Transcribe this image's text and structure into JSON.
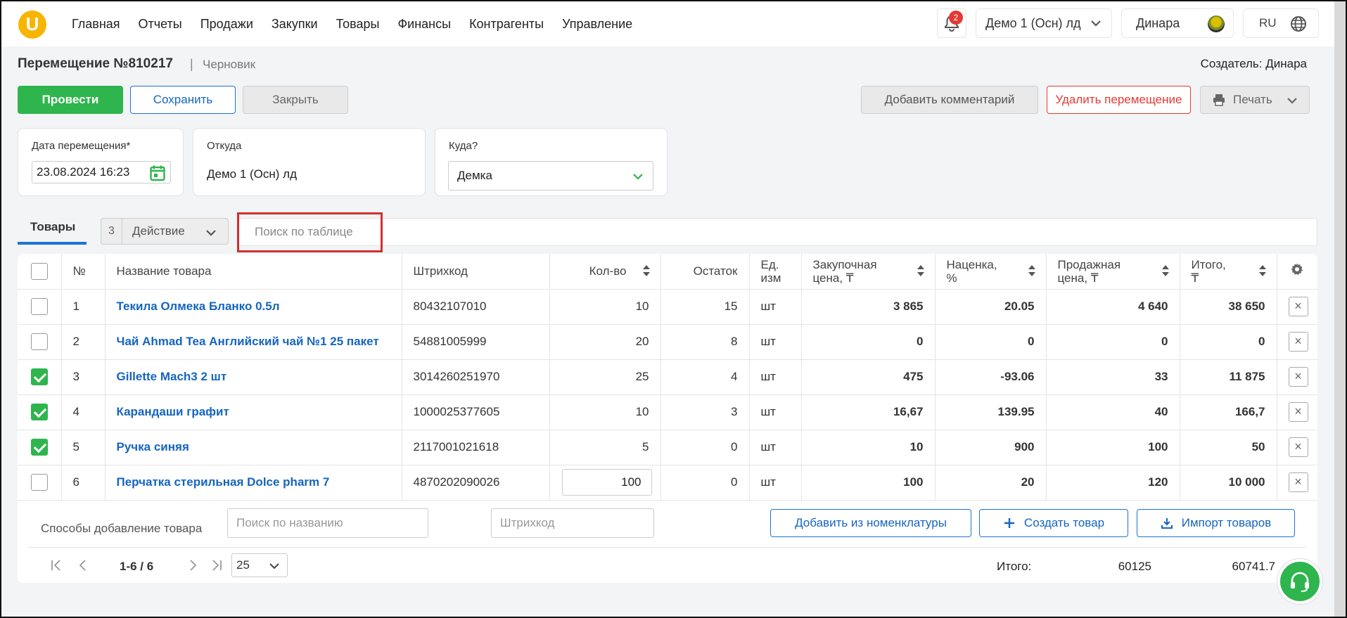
{
  "app": {
    "logo_letter": "U",
    "nav": [
      "Главная",
      "Отчеты",
      "Продажи",
      "Закупки",
      "Товары",
      "Финансы",
      "Контрагенты",
      "Управление"
    ],
    "notifications_count": "2",
    "organization": "Демо 1 (Осн) лд",
    "user_name": "Динара",
    "language": "RU"
  },
  "document": {
    "title": "Перемещение №810217",
    "separator": "|",
    "status": "Черновик",
    "creator": "Создатель: Динара"
  },
  "actions": {
    "post": "Провести",
    "save": "Сохранить",
    "close": "Закрыть",
    "add_comment": "Добавить комментарий",
    "delete": "Удалить перемещение",
    "print": "Печать"
  },
  "form": {
    "date_label": "Дата перемещения*",
    "date_value": "23.08.2024 16:23",
    "from_label": "Откуда",
    "from_value": "Демо 1 (Осн) лд",
    "to_label": "Куда?",
    "to_value": "Демка"
  },
  "toolbar": {
    "tab_products": "Товары",
    "selected_count": "3",
    "action_label": "Действие",
    "search_placeholder": "Поиск по таблице"
  },
  "table": {
    "columns": [
      "№",
      "Название товара",
      "Штрихкод",
      "Кол-во",
      "Остаток",
      "Ед. изм",
      "Закупочная цена, ₸",
      "Наценка, %",
      "Продажная цена, ₸",
      "Итого, ₸"
    ],
    "column_lines": {
      "unit": [
        "Ед.",
        "изм"
      ],
      "purchase": [
        "Закупочная",
        "цена, ₸"
      ],
      "markup": [
        "Наценка,",
        "%"
      ],
      "sale": [
        "Продажная",
        "цена, ₸"
      ],
      "total": [
        "Итого,",
        "₸"
      ]
    },
    "rows": [
      {
        "checked": false,
        "n": "1",
        "name": "Текила Олмека Бланко 0.5л",
        "barcode": "80432107010",
        "qty": "10",
        "stock": "15",
        "unit": "шт",
        "purchase": "3 865",
        "markup": "20.05",
        "sale": "4 640",
        "total": "38 650"
      },
      {
        "checked": false,
        "n": "2",
        "name": "Чай Ahmad Tea Английский чай №1 25 пакет",
        "barcode": "54881005999",
        "qty": "20",
        "stock": "8",
        "unit": "шт",
        "purchase": "0",
        "markup": "0",
        "sale": "0",
        "total": "0"
      },
      {
        "checked": true,
        "n": "3",
        "name": "Gillette Mach3 2 шт",
        "barcode": "3014260251970",
        "qty": "25",
        "stock": "4",
        "unit": "шт",
        "purchase": "475",
        "markup": "-93.06",
        "sale": "33",
        "total": "11 875"
      },
      {
        "checked": true,
        "n": "4",
        "name": "Карандаши графит",
        "barcode": "1000025377605",
        "qty": "10",
        "stock": "3",
        "unit": "шт",
        "purchase": "16,67",
        "markup": "139.95",
        "sale": "40",
        "total": "166,7"
      },
      {
        "checked": true,
        "n": "5",
        "name": "Ручка синяя",
        "barcode": "2117001021618",
        "qty": "5",
        "stock": "0",
        "unit": "шт",
        "purchase": "10",
        "markup": "900",
        "sale": "100",
        "total": "50"
      },
      {
        "checked": false,
        "n": "6",
        "name": "Перчатка стерильная Dolce pharm 7",
        "barcode": "4870202090026",
        "qty": "100",
        "stock": "0",
        "unit": "шт",
        "purchase": "100",
        "markup": "20",
        "sale": "120",
        "total": "10 000",
        "editing": true
      }
    ]
  },
  "add_products": {
    "label": "Способы добавление товара",
    "name_placeholder": "Поиск по названию",
    "barcode_placeholder": "Штрихкод",
    "from_catalog": "Добавить из номенклатуры",
    "create": "Создать товар",
    "import": "Импорт товаров"
  },
  "pager": {
    "range": "1-6 / 6",
    "per_page": "25",
    "total_label": "Итого:",
    "total_qty": "60125",
    "total_sum": "60741.7"
  },
  "colors": {
    "primary_green": "#2fb54d",
    "link_blue": "#1565c0",
    "danger_red": "#e53935",
    "logo_yellow": "#f7b500"
  }
}
